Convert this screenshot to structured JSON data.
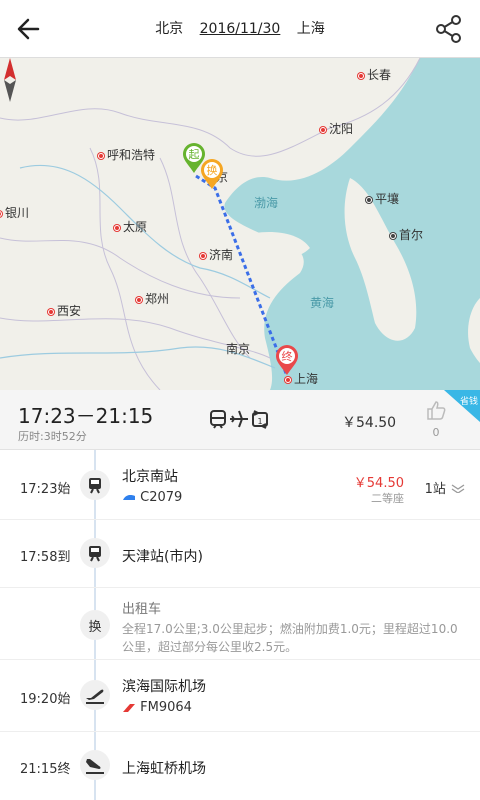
{
  "header": {
    "origin": "北京",
    "date": "2016/11/30",
    "destination": "上海"
  },
  "map": {
    "cities": [
      {
        "name": "长春"
      },
      {
        "name": "沈阳"
      },
      {
        "name": "呼和浩特"
      },
      {
        "name": "银川"
      },
      {
        "name": "太原"
      },
      {
        "name": "济南"
      },
      {
        "name": "郑州"
      },
      {
        "name": "西安"
      },
      {
        "name": "南京"
      },
      {
        "name": "上海"
      },
      {
        "name": "平壤"
      },
      {
        "name": "首尔"
      },
      {
        "name": "京"
      }
    ],
    "seas": [
      "渤海",
      "黄海"
    ],
    "pins": {
      "start": "起",
      "transfer": "换",
      "end": "终"
    },
    "colors": {
      "land": "#f1f0ea",
      "sea": "#a8d8dc",
      "route": "#3b6ee8",
      "start_pin": "#66b32e",
      "transfer_pin": "#f5a623",
      "end_pin": "#e9484a"
    }
  },
  "summary": {
    "time_range": "17:23－21:15",
    "duration": "历时:3时52分",
    "price": "￥54.50",
    "like_count": "0",
    "badge": "省钱"
  },
  "steps": [
    {
      "time": "17:23始",
      "icon": "train-icon",
      "station": "北京南站",
      "train": "C2079",
      "price": "￥54.50",
      "seat": "二等座",
      "stops": "1站"
    },
    {
      "time": "17:58到",
      "icon": "train-icon",
      "station": "天津站(市内)"
    },
    {
      "icon_text": "换",
      "name": "出租车",
      "desc": "全程17.0公里;3.0公里起步；燃油附加费1.0元；里程超过10.0公里，超过部分每公里收2.5元。"
    },
    {
      "time": "19:20始",
      "icon": "plane-takeoff-icon",
      "station": "滨海国际机场",
      "flight": "FM9064"
    },
    {
      "time": "21:15终",
      "icon": "plane-landing-icon",
      "station": "上海虹桥机场"
    }
  ]
}
